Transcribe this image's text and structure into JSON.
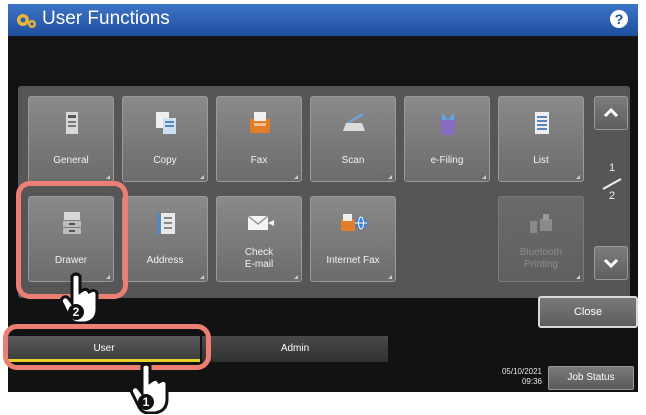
{
  "header": {
    "title": "User Functions",
    "help_icon": "question-icon"
  },
  "tiles": [
    {
      "label": "General",
      "icon": "general-icon",
      "enabled": true
    },
    {
      "label": "Copy",
      "icon": "copy-icon",
      "enabled": true
    },
    {
      "label": "Fax",
      "icon": "fax-icon",
      "enabled": true
    },
    {
      "label": "Scan",
      "icon": "scan-icon",
      "enabled": true
    },
    {
      "label": "e-Filing",
      "icon": "efiling-icon",
      "enabled": true
    },
    {
      "label": "List",
      "icon": "list-icon",
      "enabled": true
    },
    {
      "label": "Drawer",
      "icon": "drawer-icon",
      "enabled": true
    },
    {
      "label": "Address",
      "icon": "address-book-icon",
      "enabled": true
    },
    {
      "label": "Check\nE-mail",
      "icon": "envelope-icon",
      "enabled": true
    },
    {
      "label": "Internet Fax",
      "icon": "internet-fax-icon",
      "enabled": true
    },
    {
      "label": "Bluetooth\nPrinting",
      "icon": "bluetooth-printing-icon",
      "enabled": false
    }
  ],
  "pagination": {
    "current": "1",
    "total": "2"
  },
  "close_label": "Close",
  "tabs": {
    "user": "User",
    "admin": "Admin"
  },
  "status": {
    "date": "05/10/2021",
    "time": "09:36",
    "job_status": "Job Status"
  },
  "callouts": {
    "step1": "1",
    "step2": "2"
  },
  "colors": {
    "title_bar": "#2a5fb0",
    "highlight": "#ec7f74",
    "tab_underline": "#e8d02a"
  }
}
